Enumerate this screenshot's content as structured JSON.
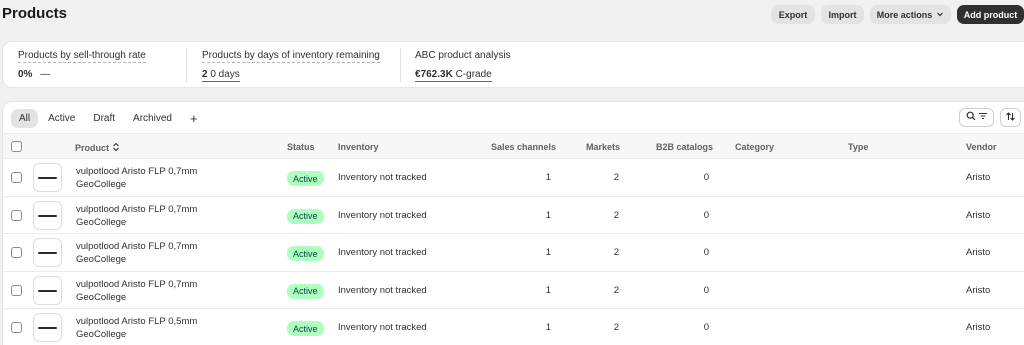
{
  "header": {
    "title": "Products",
    "export_label": "Export",
    "import_label": "Import",
    "more_actions_label": "More actions",
    "add_product_label": "Add product"
  },
  "analytics": {
    "sell_through": {
      "label": "Products by sell-through rate",
      "value": "0%",
      "trend": "—"
    },
    "days_inventory": {
      "label": "Products by days of inventory remaining",
      "value": "2",
      "suffix": "0 days"
    },
    "abc": {
      "label": "ABC product analysis",
      "value": "€762.3K",
      "suffix": "C-grade"
    }
  },
  "tabs": [
    {
      "label": "All",
      "active": true
    },
    {
      "label": "Active",
      "active": false
    },
    {
      "label": "Draft",
      "active": false
    },
    {
      "label": "Archived",
      "active": false
    }
  ],
  "add_view_label": "+",
  "columns": {
    "product": "Product",
    "status": "Status",
    "inventory": "Inventory",
    "sales_channels": "Sales channels",
    "markets": "Markets",
    "b2b": "B2B catalogs",
    "category": "Category",
    "type": "Type",
    "vendor": "Vendor"
  },
  "rows": [
    {
      "name": "vulpotlood Aristo FLP 0,7mm GeoCollege",
      "status": "Active",
      "inventory": "Inventory not tracked",
      "sales_channels": "1",
      "markets": "2",
      "b2b": "0",
      "category": "",
      "type": "",
      "vendor": "Aristo"
    },
    {
      "name": "vulpotlood Aristo FLP 0,7mm GeoCollege",
      "status": "Active",
      "inventory": "Inventory not tracked",
      "sales_channels": "1",
      "markets": "2",
      "b2b": "0",
      "category": "",
      "type": "",
      "vendor": "Aristo"
    },
    {
      "name": "vulpotlood Aristo FLP 0,7mm GeoCollege",
      "status": "Active",
      "inventory": "Inventory not tracked",
      "sales_channels": "1",
      "markets": "2",
      "b2b": "0",
      "category": "",
      "type": "",
      "vendor": "Aristo"
    },
    {
      "name": "vulpotlood Aristo FLP 0,7mm GeoCollege",
      "status": "Active",
      "inventory": "Inventory not tracked",
      "sales_channels": "1",
      "markets": "2",
      "b2b": "0",
      "category": "",
      "type": "",
      "vendor": "Aristo"
    },
    {
      "name": "vulpotlood Aristo FLP 0,5mm GeoCollege",
      "status": "Active",
      "inventory": "Inventory not tracked",
      "sales_channels": "1",
      "markets": "2",
      "b2b": "0",
      "category": "",
      "type": "",
      "vendor": "Aristo"
    }
  ],
  "colors": {
    "badge_bg": "#affebf",
    "badge_text": "#014b40",
    "primary_button": "#303030"
  },
  "icons": {
    "sort": "sort-icon",
    "search_filter": "search-filter-icon",
    "sort_toggle": "sort-toggle-icon",
    "chevron": "chevron-down-icon"
  }
}
